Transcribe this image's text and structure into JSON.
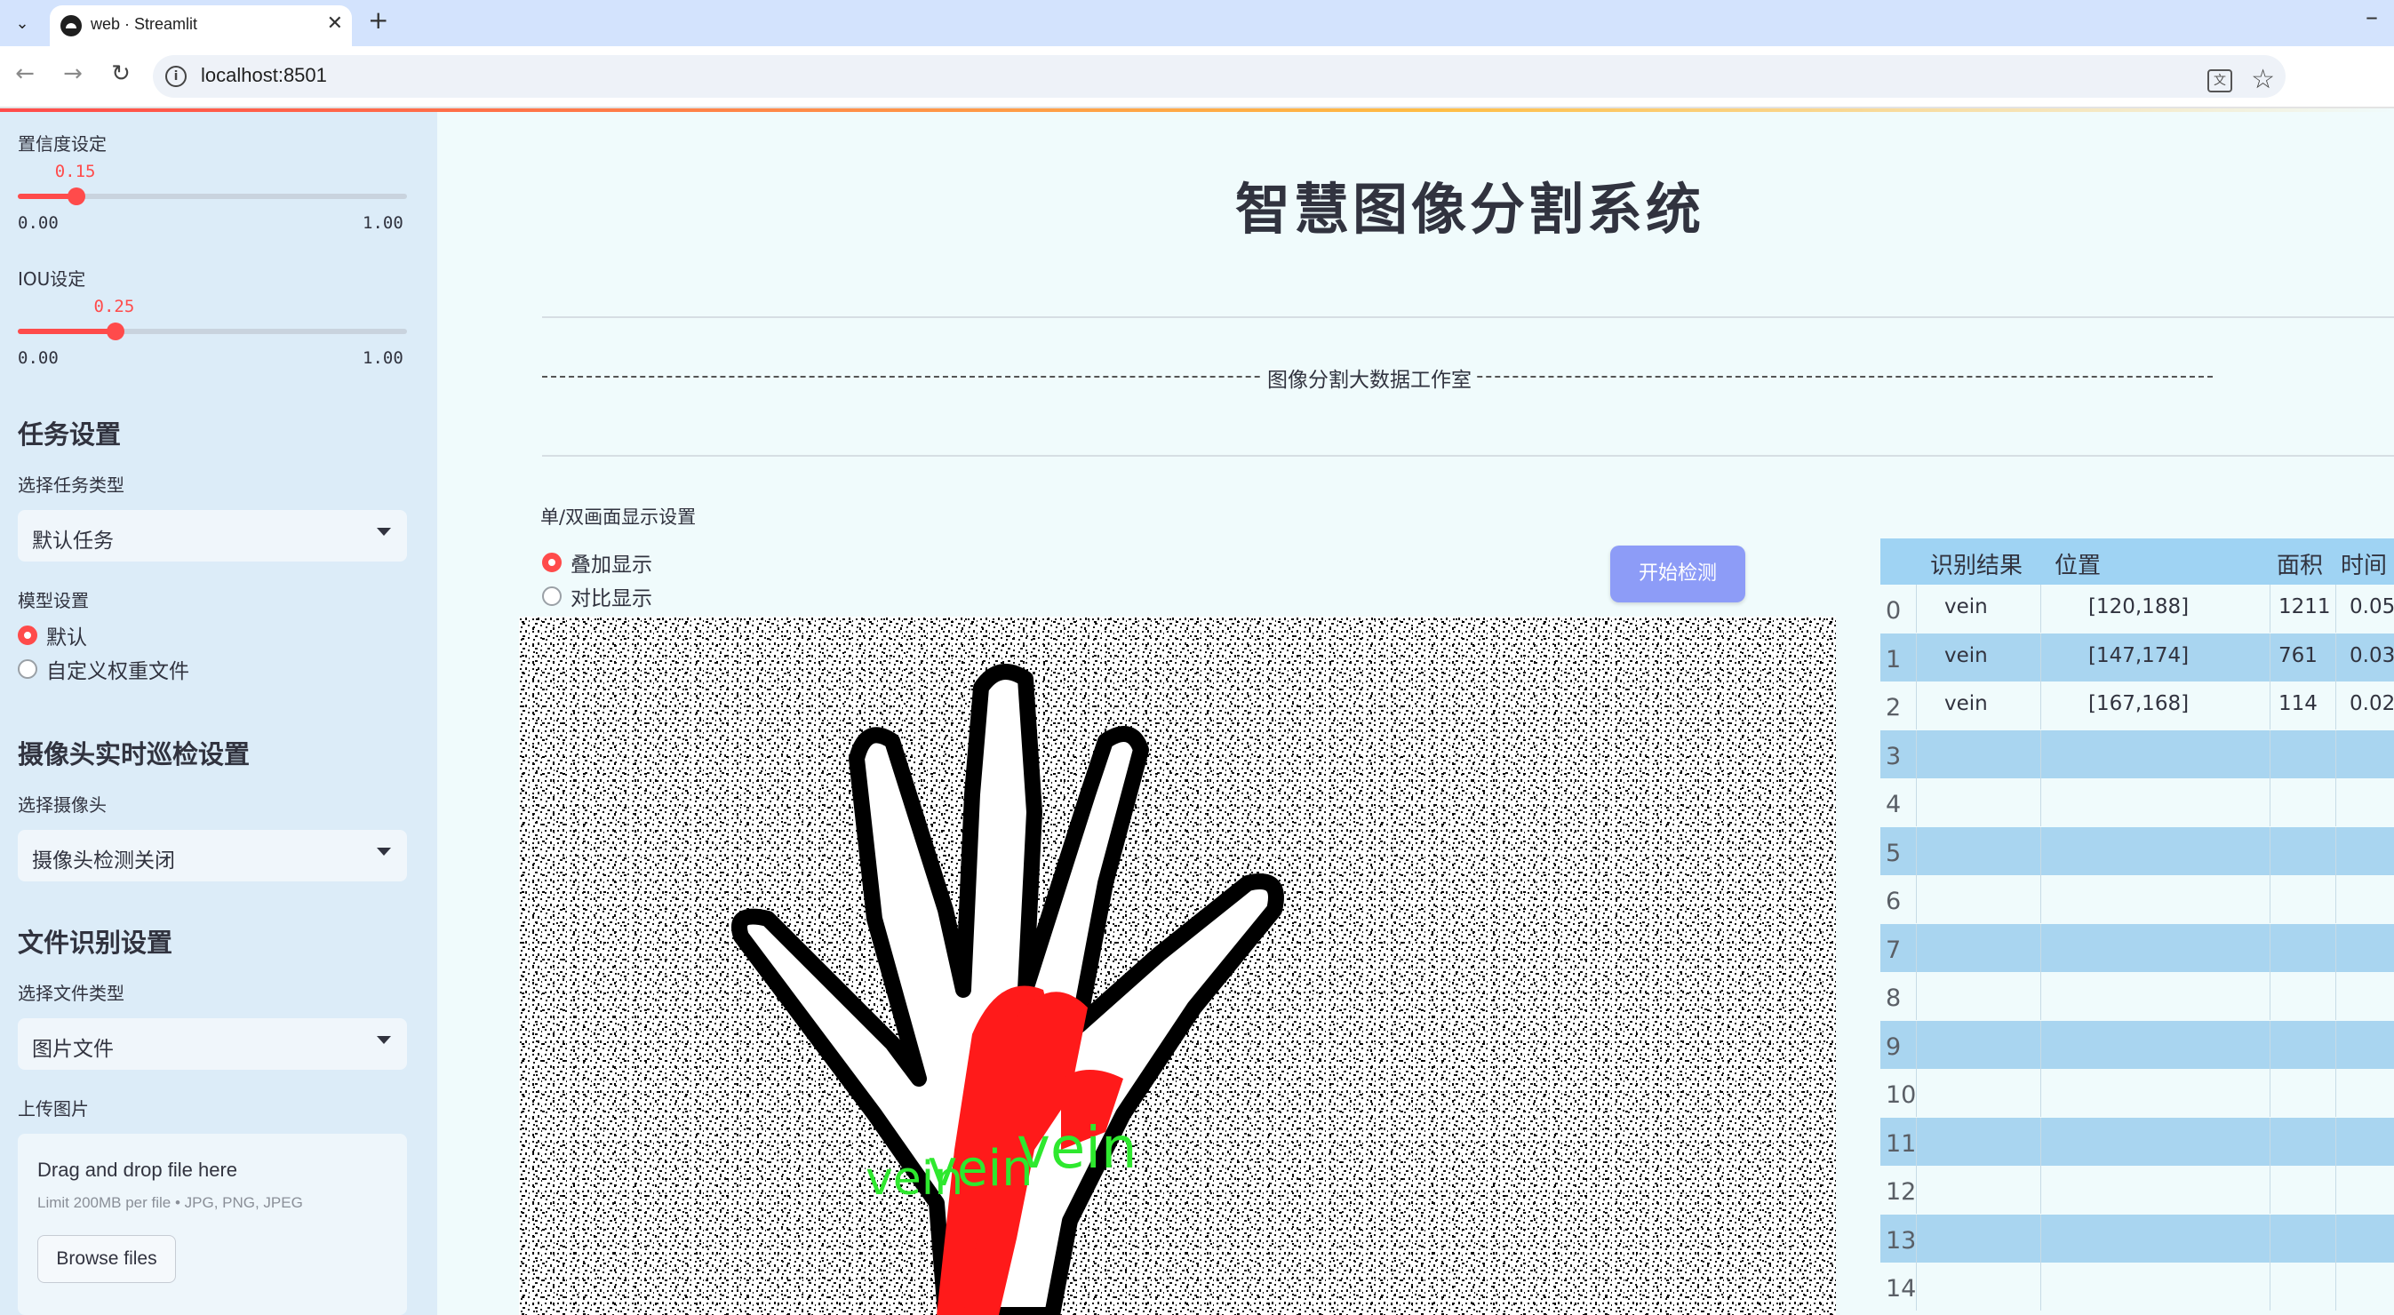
{
  "browser": {
    "tab_title": "web · Streamlit",
    "url": "localhost:8501"
  },
  "sidebar": {
    "confidence": {
      "label": "置信度设定",
      "value": 0.15,
      "value_text": "0.15",
      "min_text": "0.00",
      "max_text": "1.00"
    },
    "iou": {
      "label": "IOU设定",
      "value": 0.25,
      "value_text": "0.25",
      "min_text": "0.00",
      "max_text": "1.00"
    },
    "task": {
      "heading": "任务设置",
      "label": "选择任务类型",
      "selected": "默认任务"
    },
    "model": {
      "label": "模型设置",
      "options": [
        "默认",
        "自定义权重文件"
      ],
      "selected_index": 0
    },
    "camera": {
      "heading": "摄像头实时巡检设置",
      "label": "选择摄像头",
      "selected": "摄像头检测关闭"
    },
    "file": {
      "heading": "文件识别设置",
      "label": "选择文件类型",
      "selected": "图片文件"
    },
    "upload": {
      "label": "上传图片",
      "drop_text": "Drag and drop file here",
      "limit_text": "Limit 200MB per file • JPG, PNG, JPEG",
      "button": "Browse files"
    }
  },
  "main": {
    "title": "智慧图像分割系统",
    "banner": "图像分割大数据工作室",
    "display": {
      "label": "单/双画面显示设置",
      "options": [
        "叠加显示",
        "对比显示"
      ],
      "selected_index": 0
    },
    "start_button": "开始检测",
    "image_overlay_label": "vein",
    "accent_color": "#ff4b4b",
    "button_color": "#8d9cf7"
  },
  "table": {
    "headers": [
      "识别结果",
      "位置",
      "面积",
      "时间"
    ],
    "rows": [
      {
        "index": "0",
        "result": "vein",
        "position": "[120,188]",
        "area": "1211",
        "time": "0.05"
      },
      {
        "index": "1",
        "result": "vein",
        "position": "[147,174]",
        "area": "761",
        "time": "0.03"
      },
      {
        "index": "2",
        "result": "vein",
        "position": "[167,168]",
        "area": "114",
        "time": "0.02"
      },
      {
        "index": "3",
        "result": "",
        "position": "",
        "area": "",
        "time": ""
      },
      {
        "index": "4",
        "result": "",
        "position": "",
        "area": "",
        "time": ""
      },
      {
        "index": "5",
        "result": "",
        "position": "",
        "area": "",
        "time": ""
      },
      {
        "index": "6",
        "result": "",
        "position": "",
        "area": "",
        "time": ""
      },
      {
        "index": "7",
        "result": "",
        "position": "",
        "area": "",
        "time": ""
      },
      {
        "index": "8",
        "result": "",
        "position": "",
        "area": "",
        "time": ""
      },
      {
        "index": "9",
        "result": "",
        "position": "",
        "area": "",
        "time": ""
      },
      {
        "index": "10",
        "result": "",
        "position": "",
        "area": "",
        "time": ""
      },
      {
        "index": "11",
        "result": "",
        "position": "",
        "area": "",
        "time": ""
      },
      {
        "index": "12",
        "result": "",
        "position": "",
        "area": "",
        "time": ""
      },
      {
        "index": "13",
        "result": "",
        "position": "",
        "area": "",
        "time": ""
      },
      {
        "index": "14",
        "result": "",
        "position": "",
        "area": "",
        "time": ""
      }
    ]
  }
}
